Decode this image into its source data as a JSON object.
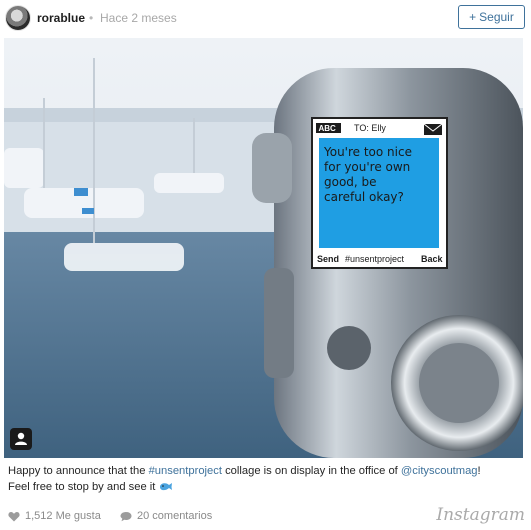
{
  "post": {
    "username": "rorablue",
    "separator": "•",
    "time_ago": "Hace 2 meses",
    "follow_label": "Seguir",
    "follow_icon": "+"
  },
  "photo": {
    "note": {
      "app_badge": "ABC",
      "to_line": "TO: Elly",
      "message_lines": [
        "You're too nice",
        "for you're own",
        "good, be",
        "careful okay?"
      ],
      "send_label": "Send",
      "hashtag": "#unsentproject",
      "back_label": "Back"
    },
    "icons": [
      "user-tag-icon",
      "envelope-icon"
    ]
  },
  "caption": {
    "text_before": "Happy to announce that the ",
    "hashtag": "#unsentproject",
    "text_middle": " collage is on display in the office of ",
    "mention": "@cityscoutmag",
    "text_after": "!",
    "line2": "Feel free to stop by and see it",
    "emoji": "whale-emoji"
  },
  "footer": {
    "likes": "1,512 Me gusta",
    "comments": "20 comentarios",
    "brand": "Instagram"
  },
  "colors": {
    "link": "#3f729b",
    "note_blue": "#1f9ee3",
    "muted_text": "#8a8a8a"
  }
}
